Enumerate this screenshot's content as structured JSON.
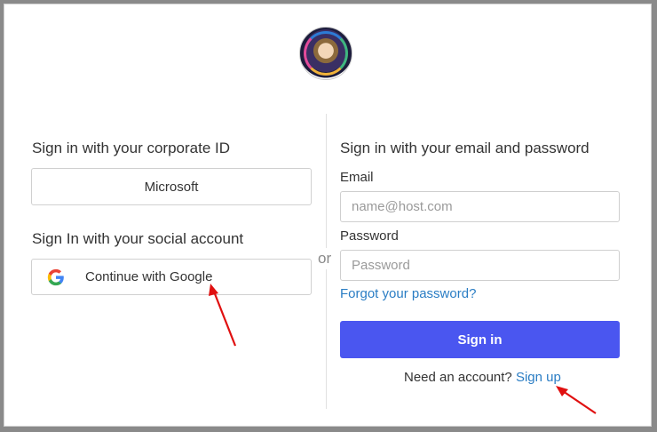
{
  "corporate": {
    "heading": "Sign in with your corporate ID",
    "microsoft_button": "Microsoft"
  },
  "social": {
    "heading": "Sign In with your social account",
    "google_button": "Continue with Google"
  },
  "separator": "or",
  "email_login": {
    "heading": "Sign in with your email and password",
    "email_label": "Email",
    "email_placeholder": "name@host.com",
    "password_label": "Password",
    "password_placeholder": "Password",
    "forgot_link": "Forgot your password?",
    "sign_in_button": "Sign in",
    "need_account_text": "Need an account?",
    "sign_up_link": "Sign up"
  },
  "colors": {
    "primary_button": "#4a56f0",
    "link": "#2a7dc4",
    "annotation_arrow": "#e01010"
  },
  "icons": {
    "logo": "wizard-avatar-logo",
    "google": "google-g-icon"
  }
}
